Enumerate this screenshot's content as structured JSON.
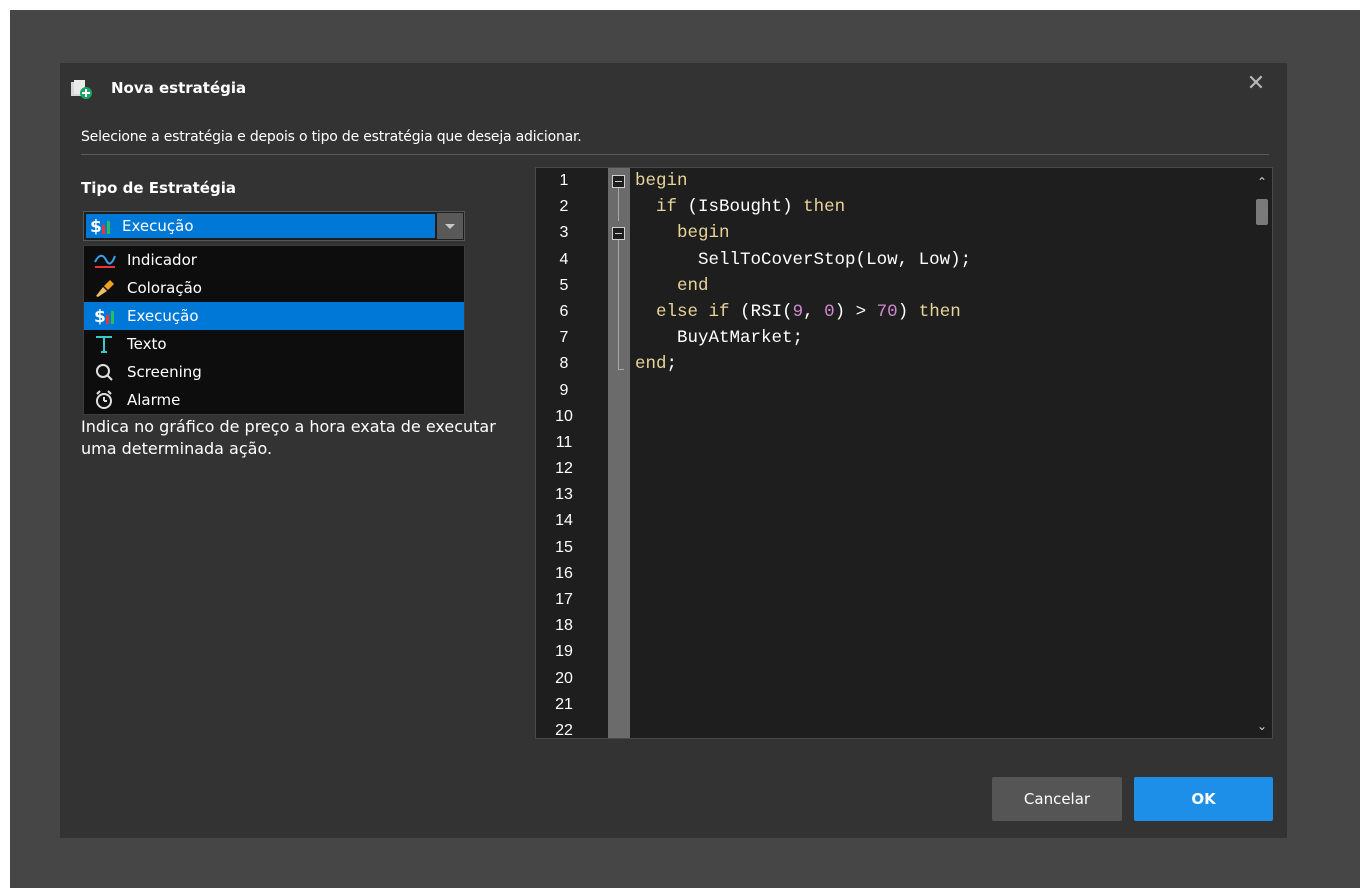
{
  "dialog": {
    "title": "Nova estratégia",
    "close_symbol": "✕",
    "subtitle": "Selecione a estratégia e depois o tipo de estratégia que deseja adicionar."
  },
  "strategy_type": {
    "label": "Tipo de Estratégia",
    "selected": "Execução",
    "options": [
      {
        "label": "Indicador",
        "icon": "indicator-icon"
      },
      {
        "label": "Coloração",
        "icon": "coloring-icon"
      },
      {
        "label": "Execução",
        "icon": "execution-icon"
      },
      {
        "label": "Texto",
        "icon": "text-icon"
      },
      {
        "label": "Screening",
        "icon": "search-icon"
      },
      {
        "label": "Alarme",
        "icon": "alarm-clock-icon"
      }
    ],
    "description": "Indica no gráfico de preço a hora exata de executar uma determinada ação."
  },
  "editor": {
    "line_numbers": [
      "1",
      "2",
      "3",
      "4",
      "5",
      "6",
      "7",
      "8",
      "9",
      "10",
      "11",
      "12",
      "13",
      "14",
      "15",
      "16",
      "17",
      "18",
      "19",
      "20",
      "21",
      "22"
    ],
    "code_lines": [
      "begin",
      "  if (IsBought) then",
      "    begin",
      "      SellToCoverStop(Low, Low);",
      "    end",
      "  else if (RSI(9, 0) > 70) then",
      "    BuyAtMarket;",
      "end;"
    ],
    "scroll_up": "⌃",
    "scroll_down": "⌄"
  },
  "buttons": {
    "cancel": "Cancelar",
    "ok": "OK"
  },
  "colors": {
    "accent": "#0078d7",
    "ok_button": "#1e8fe8",
    "keyword": "#e8d39a",
    "number": "#d08ad0"
  }
}
